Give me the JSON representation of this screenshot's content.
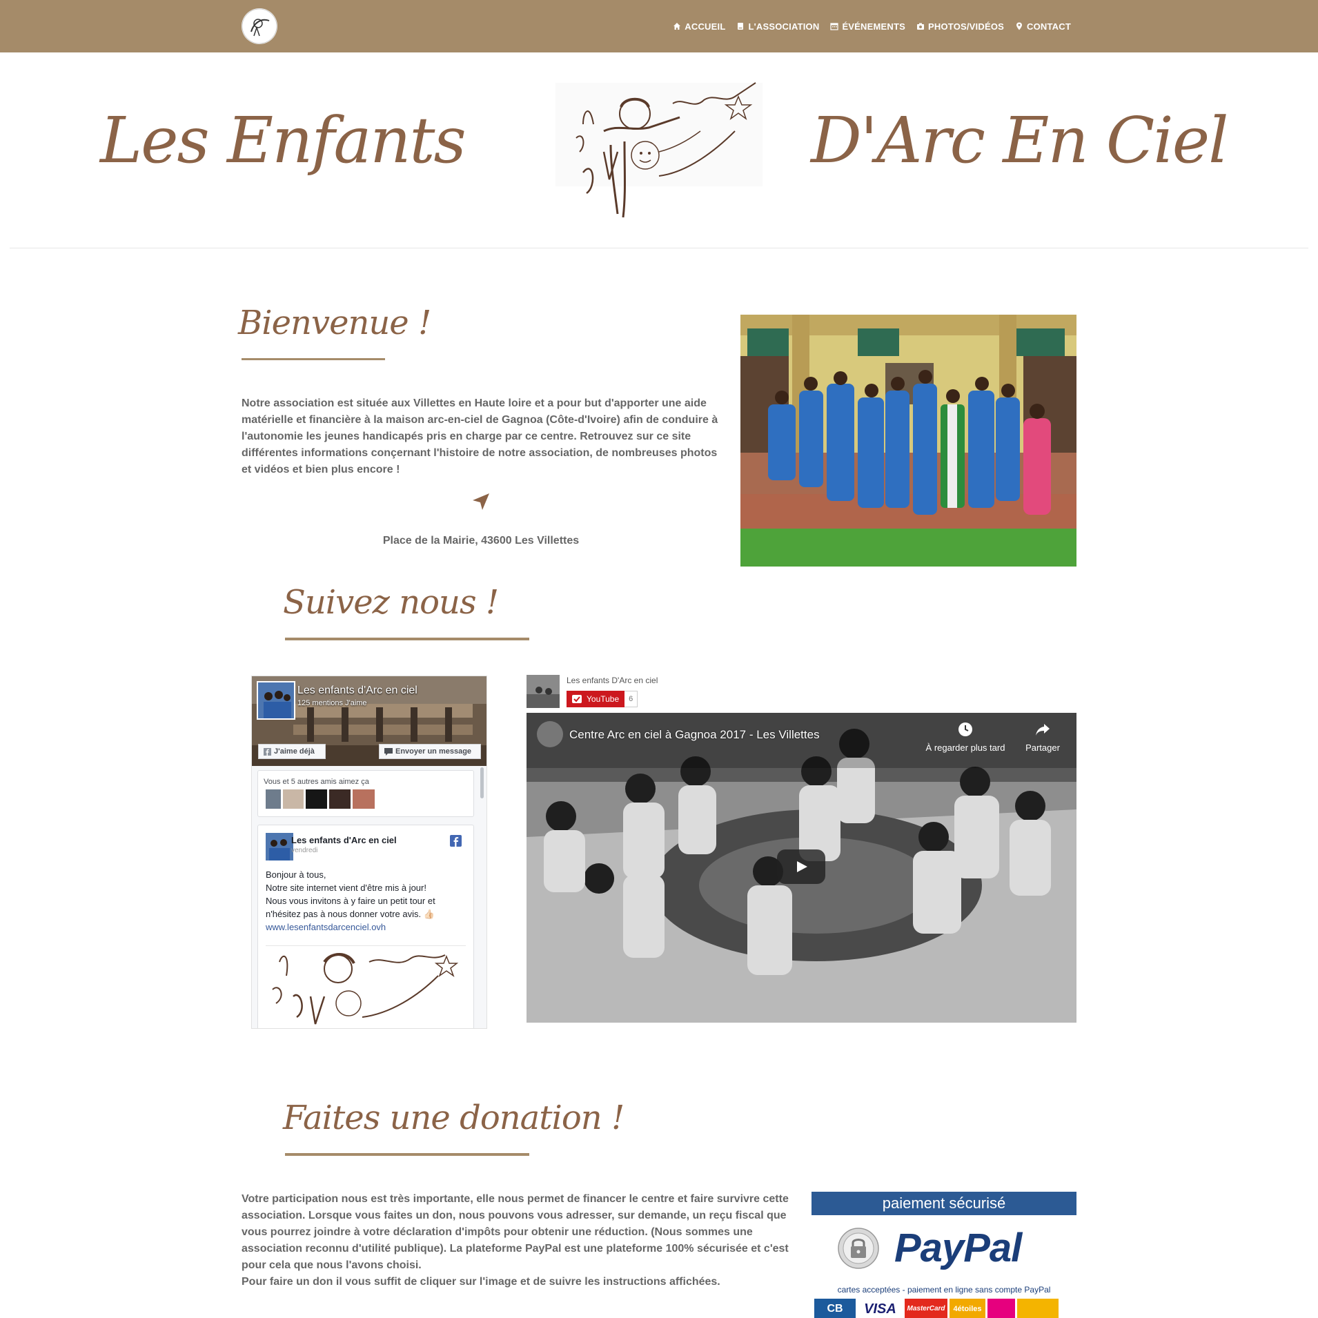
{
  "nav": {
    "items": [
      {
        "label": "ACCUEIL",
        "icon": "home-icon"
      },
      {
        "label": "L'ASSOCIATION",
        "icon": "book-icon"
      },
      {
        "label": "ÉVÉNEMENTS",
        "icon": "calendar-icon"
      },
      {
        "label": "PHOTOS/VIDÉOS",
        "icon": "camera-icon"
      },
      {
        "label": "CONTACT",
        "icon": "map-marker-icon"
      }
    ]
  },
  "banner": {
    "left_text": "Les Enfants",
    "right_text": "D'Arc En Ciel"
  },
  "welcome": {
    "title": "Bienvenue !",
    "text": "Notre association est située aux Villettes en Haute loire et a pour but d'apporter une aide matérielle et financière à la maison arc-en-ciel de Gagnoa (Côte-d'Ivoire) afin de conduire à l'autonomie les jeunes handicapés pris en charge par ce centre. Retrouvez sur ce site différentes informations conçernant l'histoire de notre association, de nombreuses photos et vidéos et bien plus encore !",
    "address": "Place de la Mairie, 43600 Les Villettes"
  },
  "follow": {
    "title": "Suivez nous !"
  },
  "facebook": {
    "page_name": "Les enfants d'Arc en ciel",
    "likes": "125 mentions J'aime",
    "like_button": "J'aime déjà",
    "message_button": "Envoyer un message",
    "friends_text": "Vous et 5 autres amis aimez ça",
    "post": {
      "author": "Les enfants d'Arc en ciel",
      "date": "vendredi",
      "lines": [
        "Bonjour à tous,",
        "Notre site internet vient d'être mis à jour!",
        "Nous vous invitons à y faire un petit tour et",
        "n'hésitez pas à nous donner votre avis. 👍🏻"
      ],
      "link": "www.lesenfantsdarcenciel.ovh"
    }
  },
  "youtube": {
    "channel": "Les enfants D'Arc en ciel",
    "subscribe_label": "YouTube",
    "subscriber_count": "6",
    "video_title": "Centre Arc en ciel à Gagnoa 2017 - Les Villettes",
    "watch_later": "À regarder plus tard",
    "share": "Partager"
  },
  "donation": {
    "title": "Faites une donation !",
    "text_lines": "Votre participation nous est très importante, elle nous permet de financer le centre et faire survivre cette association. Lorsque vous faites un don, nous pouvons vous adresser, sur demande, un reçu fiscal que vous pourrez joindre à votre déclaration d'impôts pour obtenir une réduction. (Nous sommes une association reconnu d'utilité publique). La plateforme PayPal est une plateforme 100% sécurisée et c'est pour cela que nous l'avons choisi.",
    "instruction": "Pour faire un don il vous suffit de cliquer sur l'image et de suivre les instructions affichées.",
    "paypal_header": "paiement sécurisé",
    "paypal_logo": "PayPal",
    "paypal_caption": "cartes acceptées - paiement en ligne sans compte PayPal",
    "cards": [
      "CB",
      "VISA",
      "MasterCard",
      "4étoiles"
    ]
  },
  "colors": {
    "nav_bg": "#a58b69",
    "accent_brown": "#8b6347",
    "paypal_blue": "#2c5a94"
  }
}
